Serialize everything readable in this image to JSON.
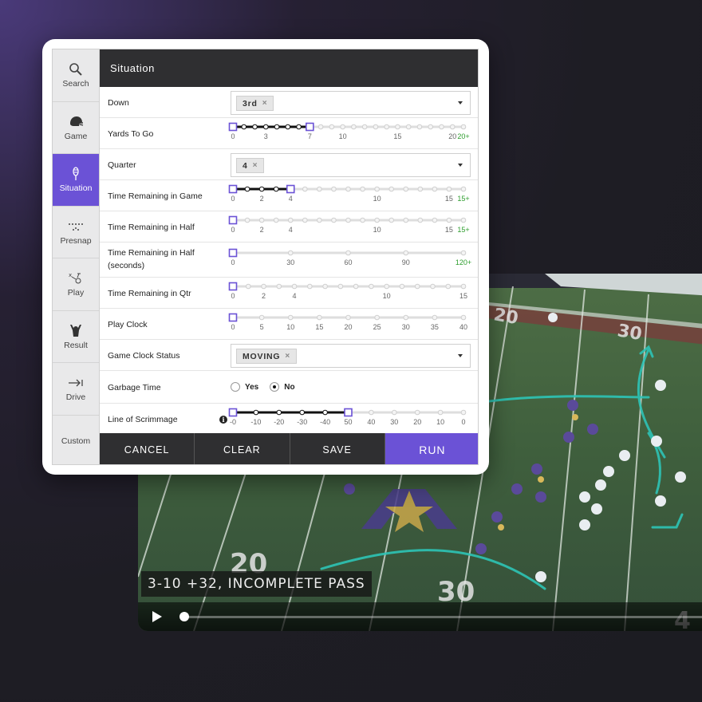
{
  "panel": {
    "header_title": "Situation",
    "sidebar": [
      {
        "label": "Search",
        "icon": "search-icon"
      },
      {
        "label": "Game",
        "icon": "helmet-icon"
      },
      {
        "label": "Situation",
        "icon": "whistle-icon",
        "active": true
      },
      {
        "label": "Presnap",
        "icon": "formation-icon"
      },
      {
        "label": "Play",
        "icon": "play-diagram-icon"
      },
      {
        "label": "Result",
        "icon": "touchdown-icon"
      },
      {
        "label": "Drive",
        "icon": "arrow-right-icon"
      },
      {
        "label": "Custom",
        "icon": ""
      }
    ],
    "rows": {
      "down": {
        "label": "Down",
        "value": "3rd",
        "remove": "×"
      },
      "yards_to_go": {
        "label": "Yards To Go",
        "ticks": [
          "0",
          "3",
          "7",
          "10",
          "15",
          "20",
          "20+"
        ],
        "selected_range": [
          0,
          7
        ]
      },
      "quarter": {
        "label": "Quarter",
        "value": "4",
        "remove": "×"
      },
      "time_game": {
        "label": "Time Remaining in Game",
        "ticks": [
          "0",
          "2",
          "4",
          "10",
          "15",
          "15+"
        ],
        "selected_range": [
          0,
          4
        ]
      },
      "time_half": {
        "label": "Time Remaining in Half",
        "ticks": [
          "0",
          "2",
          "4",
          "10",
          "15",
          "15+"
        ],
        "selected_range": [
          0,
          0
        ]
      },
      "time_half_sec": {
        "label_line1": "Time Remaining in Half",
        "label_line2": "(seconds)",
        "ticks": [
          "0",
          "30",
          "60",
          "90",
          "120+"
        ],
        "selected_range": [
          0,
          0
        ]
      },
      "time_qtr": {
        "label": "Time Remaining in Qtr",
        "ticks": [
          "0",
          "2",
          "4",
          "10",
          "15"
        ],
        "selected_range": [
          0,
          0
        ]
      },
      "play_clock": {
        "label": "Play Clock",
        "ticks": [
          "0",
          "5",
          "10",
          "15",
          "20",
          "25",
          "30",
          "35",
          "40"
        ],
        "selected_range": [
          0,
          0
        ]
      },
      "game_clock": {
        "label": "Game Clock Status",
        "value": "MOVING",
        "remove": "×"
      },
      "garbage_time": {
        "label": "Garbage Time",
        "options": [
          "Yes",
          "No"
        ],
        "selected": "No"
      },
      "line_of_scrimmage": {
        "label": "Line of Scrimmage",
        "info": "i",
        "ticks": [
          "-0",
          "-10",
          "-20",
          "-30",
          "-40",
          "50",
          "40",
          "30",
          "20",
          "10",
          "0"
        ],
        "selected_range": [
          "-0",
          "50"
        ]
      }
    },
    "footer": {
      "cancel": "CANCEL",
      "clear": "CLEAR",
      "save": "SAVE",
      "run": "RUN"
    }
  },
  "video": {
    "caption": "3-10 +32, INCOMPLETE PASS",
    "field_numbers": [
      "20",
      "30",
      "20",
      "30",
      "4"
    ],
    "progress": 0.0
  },
  "colors": {
    "accent": "#6b52d6",
    "header": "#2f2f31",
    "route": "#2ec4b6",
    "plus_label": "#2e9e2e"
  }
}
